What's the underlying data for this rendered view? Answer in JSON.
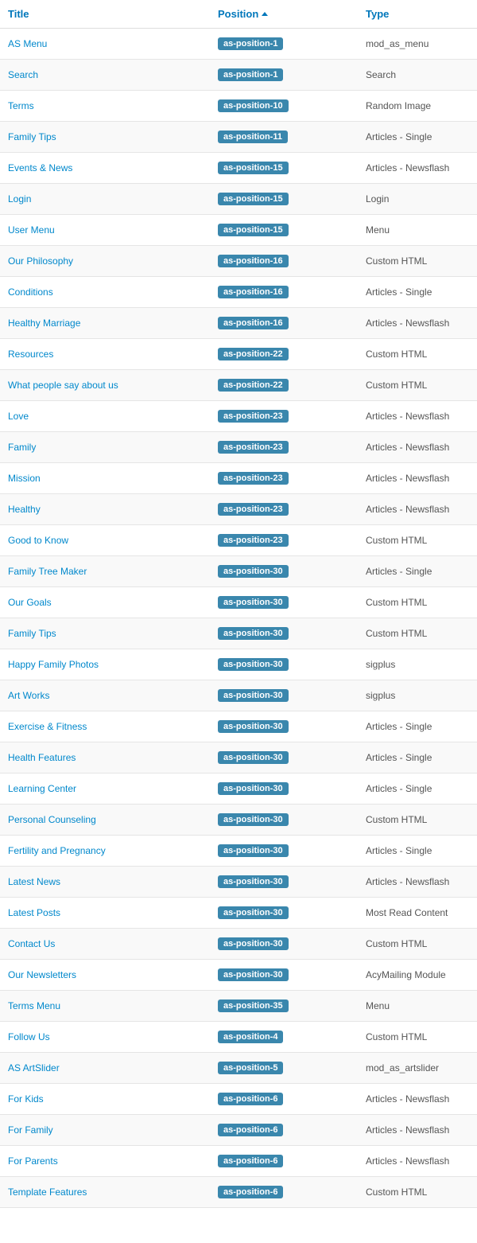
{
  "headers": {
    "title": "Title",
    "position": "Position",
    "type": "Type"
  },
  "rows": [
    {
      "title": "AS Menu",
      "position": "as-position-1",
      "type": "mod_as_menu"
    },
    {
      "title": "Search",
      "position": "as-position-1",
      "type": "Search"
    },
    {
      "title": "Terms",
      "position": "as-position-10",
      "type": "Random Image"
    },
    {
      "title": "Family Tips",
      "position": "as-position-11",
      "type": "Articles - Single"
    },
    {
      "title": "Events & News",
      "position": "as-position-15",
      "type": "Articles - Newsflash"
    },
    {
      "title": "Login",
      "position": "as-position-15",
      "type": "Login"
    },
    {
      "title": "User Menu",
      "position": "as-position-15",
      "type": "Menu"
    },
    {
      "title": "Our Philosophy",
      "position": "as-position-16",
      "type": "Custom HTML"
    },
    {
      "title": "Conditions",
      "position": "as-position-16",
      "type": "Articles - Single"
    },
    {
      "title": "Healthy Marriage",
      "position": "as-position-16",
      "type": "Articles - Newsflash"
    },
    {
      "title": "Resources",
      "position": "as-position-22",
      "type": "Custom HTML"
    },
    {
      "title": "What people say about us",
      "position": "as-position-22",
      "type": "Custom HTML"
    },
    {
      "title": "Love",
      "position": "as-position-23",
      "type": "Articles - Newsflash"
    },
    {
      "title": "Family",
      "position": "as-position-23",
      "type": "Articles - Newsflash"
    },
    {
      "title": "Mission",
      "position": "as-position-23",
      "type": "Articles - Newsflash"
    },
    {
      "title": "Healthy",
      "position": "as-position-23",
      "type": "Articles - Newsflash"
    },
    {
      "title": "Good to Know",
      "position": "as-position-23",
      "type": "Custom HTML"
    },
    {
      "title": "Family Tree Maker",
      "position": "as-position-30",
      "type": "Articles - Single"
    },
    {
      "title": "Our Goals",
      "position": "as-position-30",
      "type": "Custom HTML"
    },
    {
      "title": "Family Tips",
      "position": "as-position-30",
      "type": "Custom HTML"
    },
    {
      "title": "Happy Family Photos",
      "position": "as-position-30",
      "type": "sigplus"
    },
    {
      "title": "Art Works",
      "position": "as-position-30",
      "type": "sigplus"
    },
    {
      "title": "Exercise & Fitness",
      "position": "as-position-30",
      "type": "Articles - Single"
    },
    {
      "title": "Health Features",
      "position": "as-position-30",
      "type": "Articles - Single"
    },
    {
      "title": "Learning Center",
      "position": "as-position-30",
      "type": "Articles - Single"
    },
    {
      "title": "Personal Counseling",
      "position": "as-position-30",
      "type": "Custom HTML"
    },
    {
      "title": "Fertility and Pregnancy",
      "position": "as-position-30",
      "type": "Articles - Single"
    },
    {
      "title": "Latest News",
      "position": "as-position-30",
      "type": "Articles - Newsflash"
    },
    {
      "title": "Latest Posts",
      "position": "as-position-30",
      "type": "Most Read Content"
    },
    {
      "title": "Contact Us",
      "position": "as-position-30",
      "type": "Custom HTML"
    },
    {
      "title": "Our Newsletters",
      "position": "as-position-30",
      "type": "AcyMailing Module"
    },
    {
      "title": "Terms Menu",
      "position": "as-position-35",
      "type": "Menu"
    },
    {
      "title": "Follow Us",
      "position": "as-position-4",
      "type": "Custom HTML"
    },
    {
      "title": "AS ArtSlider",
      "position": "as-position-5",
      "type": "mod_as_artslider"
    },
    {
      "title": "For Kids",
      "position": "as-position-6",
      "type": "Articles - Newsflash"
    },
    {
      "title": "For Family",
      "position": "as-position-6",
      "type": "Articles - Newsflash"
    },
    {
      "title": "For Parents",
      "position": "as-position-6",
      "type": "Articles - Newsflash"
    },
    {
      "title": "Template Features",
      "position": "as-position-6",
      "type": "Custom HTML"
    }
  ]
}
